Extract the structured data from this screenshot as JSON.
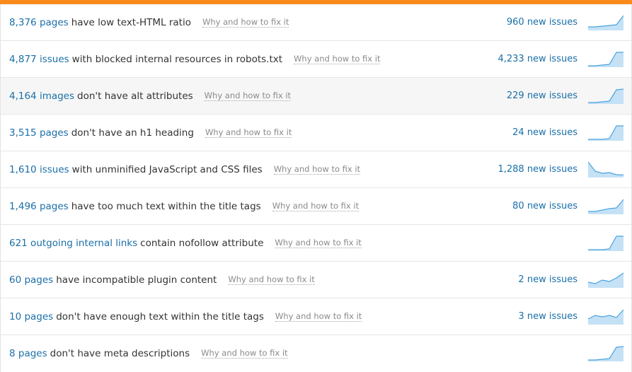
{
  "accent_color": "#f98b1d",
  "link_color": "#1a6fa8",
  "spark_fill": "#c5e1f5",
  "spark_line": "#4aa3e0",
  "fix_label": "Why and how to fix it",
  "issues": [
    {
      "count": "8,376 pages",
      "desc": "have low text-HTML ratio",
      "new": "960 new issues",
      "trend": [
        0.15,
        0.15,
        0.2,
        0.25,
        0.3,
        0.95
      ]
    },
    {
      "count": "4,877 issues",
      "desc": "with blocked internal resources in robots.txt",
      "new": "4,233 new issues",
      "trend": [
        0.0,
        0.0,
        0.05,
        0.1,
        0.95,
        0.95
      ]
    },
    {
      "count": "4,164 images",
      "desc": "don't have alt attributes",
      "new": "229 new issues",
      "trend": [
        0.0,
        0.0,
        0.05,
        0.1,
        0.9,
        0.95
      ]
    },
    {
      "count": "3,515 pages",
      "desc": "don't have an h1 heading",
      "new": "24 new issues",
      "trend": [
        0.0,
        0.0,
        0.0,
        0.05,
        0.95,
        0.95
      ]
    },
    {
      "count": "1,610 issues",
      "desc": "with unminified JavaScript and CSS files",
      "new": "1,288 new issues",
      "trend": [
        1.0,
        0.35,
        0.2,
        0.25,
        0.1,
        0.08
      ]
    },
    {
      "count": "1,496 pages",
      "desc": "have too much text within the title tags",
      "new": "80 new issues",
      "trend": [
        0.1,
        0.1,
        0.2,
        0.3,
        0.35,
        0.95
      ]
    },
    {
      "count": "621 outgoing internal links",
      "desc": "contain nofollow attribute",
      "new": "",
      "trend": [
        0.0,
        0.0,
        0.0,
        0.05,
        0.95,
        0.95
      ]
    },
    {
      "count": "60 pages",
      "desc": "have incompatible plugin content",
      "new": "2 new issues",
      "trend": [
        0.3,
        0.2,
        0.45,
        0.35,
        0.6,
        0.95
      ]
    },
    {
      "count": "10 pages",
      "desc": "don't have enough text within the title tags",
      "new": "3 new issues",
      "trend": [
        0.3,
        0.55,
        0.45,
        0.55,
        0.4,
        0.95
      ]
    },
    {
      "count": "8 pages",
      "desc": "don't have meta descriptions",
      "new": "",
      "trend": [
        0.0,
        0.0,
        0.05,
        0.1,
        0.9,
        0.95
      ]
    }
  ]
}
